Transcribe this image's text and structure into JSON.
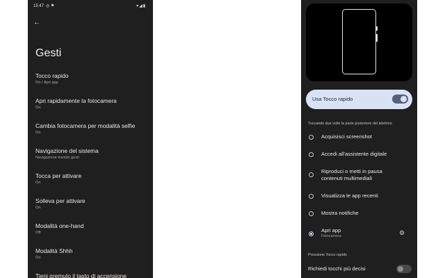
{
  "status": {
    "time": "15:47",
    "left_icons": "◎ ⚑",
    "right_icons": "▾◢▮"
  },
  "left": {
    "back_icon": "arrow-left-icon",
    "title": "Gesti",
    "items": [
      {
        "title": "Tocco rapido",
        "subtitle": "On / Apri app"
      },
      {
        "title": "Apri rapidamente la fotocamera",
        "subtitle": "On"
      },
      {
        "title": "Cambia fotocamera per modalità selfie",
        "subtitle": "On"
      },
      {
        "title": "Navigazione del sistema",
        "subtitle": "Navigazione tramite gesti"
      },
      {
        "title": "Tocca per attivare",
        "subtitle": "On"
      },
      {
        "title": "Solleva per attivare",
        "subtitle": "On"
      },
      {
        "title": "Modalità one-hand",
        "subtitle": "Off"
      },
      {
        "title": "Modalità Shhh",
        "subtitle": "On"
      },
      {
        "title": "Tieni premuto il tasto di accensione",
        "subtitle": ""
      }
    ]
  },
  "right": {
    "toggle_label": "Usa Tocco rapido",
    "section_header": "Toccando due volte la parte posteriore del telefono",
    "options": [
      {
        "label": "Acquisisci screenshot",
        "sub": ""
      },
      {
        "label": "Accedi all'assistente digitale",
        "sub": ""
      },
      {
        "label": "Riproduci o metti in pausa contenuti multimediali",
        "sub": ""
      },
      {
        "label": "Visualizza le app recenti",
        "sub": ""
      },
      {
        "label": "Mostra notifiche",
        "sub": ""
      },
      {
        "label": "Apri app",
        "sub": "Fotocamera"
      }
    ],
    "selected_option": "Apri app",
    "gear_icon": "gear-icon",
    "press_header": "Pressione Tocco rapido",
    "bottom_label": "Richiedi tocchi più decisi"
  },
  "colors": {
    "background": "#1f1f1f",
    "accent_card": "#d9e2f5",
    "switch_on": "#56607a"
  }
}
